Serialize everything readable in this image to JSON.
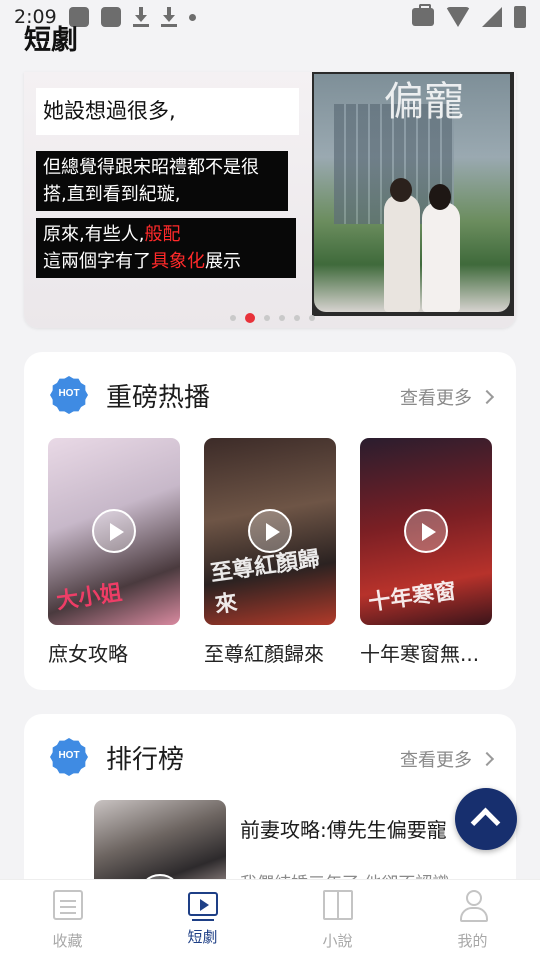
{
  "status_bar": {
    "time": "2:09"
  },
  "header": {
    "title": "短劇"
  },
  "banner": {
    "caption_1": "她設想過很多,",
    "caption_2": "但總覺得跟宋昭禮都不是很搭,直到看到紀璇,",
    "caption_3_pre": "原來,有些人,",
    "caption_3_red1": "般配",
    "caption_3_mid": "這兩個字有了",
    "caption_3_red2": "具象化",
    "caption_3_post": "展示",
    "poster_calligraphy": "偏寵",
    "pagination": {
      "total": 6,
      "active": 2
    }
  },
  "hot_section": {
    "badge": "HOT",
    "title": "重磅热播",
    "more": "查看更多",
    "items": [
      {
        "name": "庶女攻略",
        "thumb_text": "大小姐"
      },
      {
        "name": "至尊紅顏歸來",
        "thumb_text": "至尊紅顏歸來"
      },
      {
        "name": "十年寒窗無...",
        "thumb_text": "十年寒窗"
      }
    ]
  },
  "rank_section": {
    "badge": "HOT",
    "title": "排行榜",
    "more": "查看更多",
    "item": {
      "title": "前妻攻略:傅先生偏要寵",
      "desc": "我們結婚三年了,他卻不認識"
    }
  },
  "bottom_nav": {
    "items": [
      {
        "label": "收藏",
        "icon": "list-icon"
      },
      {
        "label": "短劇",
        "icon": "video-icon"
      },
      {
        "label": "小說",
        "icon": "book-icon"
      },
      {
        "label": "我的",
        "icon": "user-icon"
      }
    ],
    "active": 1
  },
  "colors": {
    "accent": "#1e3f86",
    "hot_badge": "#3f8be3",
    "highlight_red": "#ff2a2a",
    "fab": "#172f6e"
  }
}
